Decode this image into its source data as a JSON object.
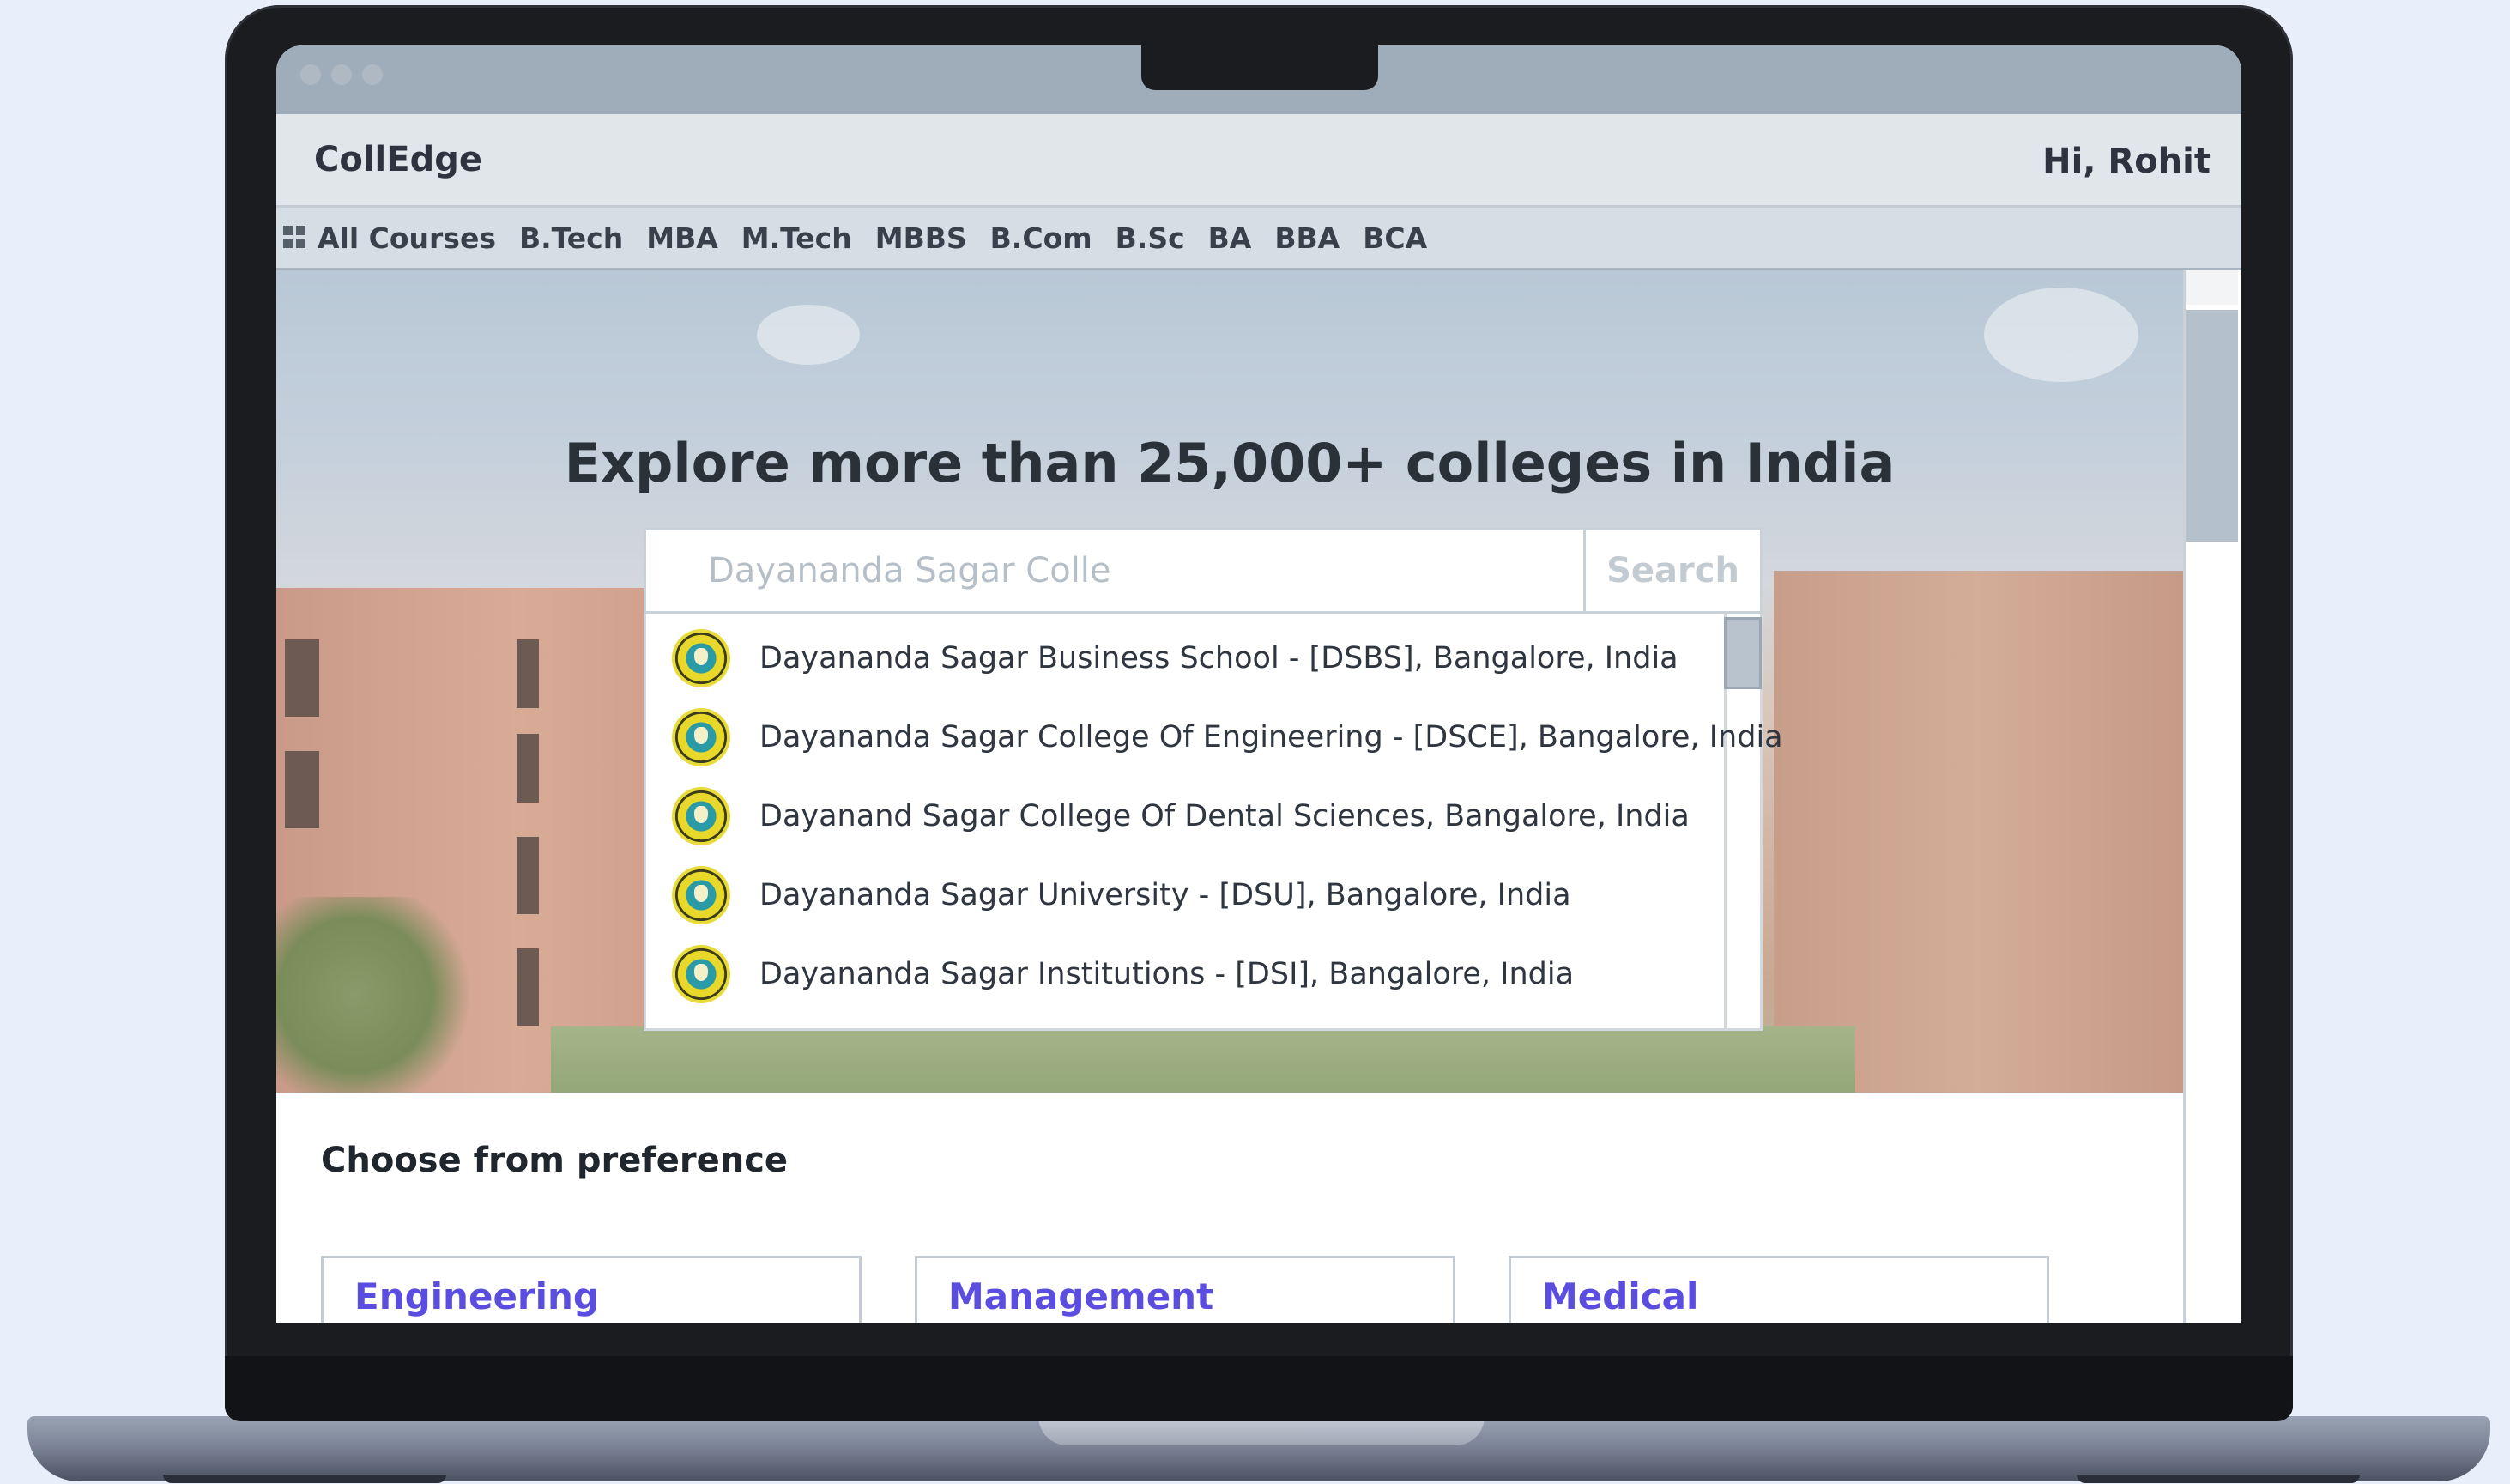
{
  "app": {
    "brand": "CollEdge",
    "greeting": "Hi, Rohit"
  },
  "courses": {
    "icon": "grid-icon",
    "items": [
      "All Courses",
      "B.Tech",
      "MBA",
      "M.Tech",
      "MBBS",
      "B.Com",
      "B.Sc",
      "BA",
      "BBA",
      "BCA"
    ]
  },
  "hero": {
    "title": "Explore more than 25,000+ colleges in India"
  },
  "search": {
    "value": "Dayananda Sagar Colle",
    "button_label": "Search",
    "suggestions": [
      "Dayananda Sagar Business School - [DSBS], Bangalore, India",
      "Dayananda Sagar College Of Engineering - [DSCE], Bangalore, India",
      "Dayanand Sagar College Of Dental Sciences, Bangalore, India",
      "Dayananda Sagar University - [DSU], Bangalore, India",
      "Dayananda Sagar Institutions - [DSI], Bangalore, India"
    ]
  },
  "preferences": {
    "title": "Choose from preference",
    "cards": [
      "Engineering",
      "Management",
      "Medical"
    ]
  },
  "colors": {
    "card_title": "#5b4de0",
    "page_bg": "#e9eefb"
  }
}
